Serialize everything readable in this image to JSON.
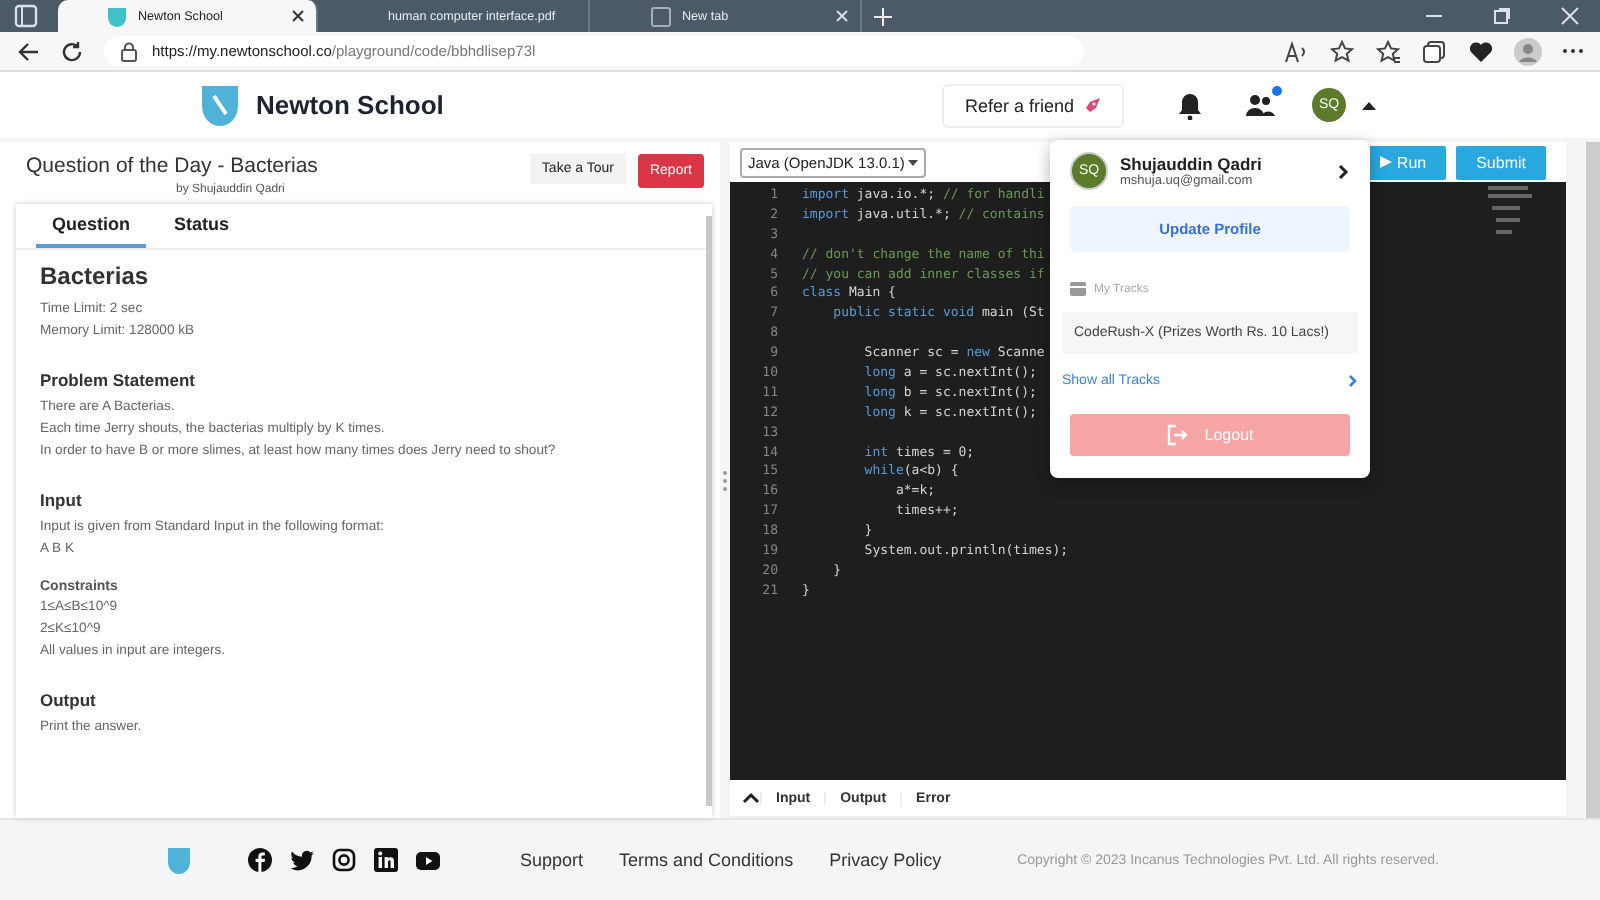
{
  "browser": {
    "tabs": [
      {
        "title": "Newton School",
        "selected": true,
        "kind": "site"
      },
      {
        "title": "human computer interface.pdf",
        "selected": false,
        "kind": "pdf"
      },
      {
        "title": "New tab",
        "selected": false,
        "kind": "blank"
      }
    ],
    "url_host": "https://my.newtonschool.co",
    "url_path": "/playground/code/bbhdlisep73l"
  },
  "header": {
    "brand": "Newton School",
    "refer": "Refer a friend",
    "avatar": "SQ",
    "notification": true
  },
  "problem": {
    "title": "Question of the Day - Bacterias",
    "author": "by Shujauddin Qadri",
    "tour": "Take a Tour",
    "report": "Report",
    "tabs": [
      {
        "label": "Question",
        "selected": true
      },
      {
        "label": "Status",
        "selected": false
      }
    ],
    "name": "Bacterias",
    "limits": [
      "Time Limit: 2 sec",
      "Memory Limit: 128000 kB"
    ],
    "sections": [
      {
        "kind": "h",
        "text": "Problem Statement"
      },
      {
        "kind": "p",
        "lines": [
          "There are A Bacterias.",
          "Each time Jerry shouts, the bacterias multiply by K times.",
          "In order to have B or more slimes, at least how many times does Jerry need to shout?"
        ]
      },
      {
        "kind": "h",
        "text": "Input"
      },
      {
        "kind": "p",
        "lines": [
          "Input is given from Standard Input in the following format:",
          "A B K"
        ]
      },
      {
        "kind": "sh",
        "text": "Constraints"
      },
      {
        "kind": "p",
        "lines": [
          "1≤A≤B≤10^9",
          "2≤K≤10^9",
          "All values in input are integers."
        ]
      },
      {
        "kind": "h",
        "text": "Output"
      },
      {
        "kind": "p",
        "lines": [
          "Print the answer."
        ]
      }
    ]
  },
  "editor": {
    "language": "Java (OpenJDK 13.0.1)",
    "run": "Run",
    "submit": "Submit",
    "lines": [
      {
        "num": "1",
        "segments": [
          {
            "text": "import",
            "kind": "keyword"
          },
          {
            "text": " java.io.*; ",
            "kind": "plain"
          },
          {
            "text": "// for handli",
            "kind": "comment"
          }
        ]
      },
      {
        "num": "2",
        "segments": [
          {
            "text": "import",
            "kind": "keyword"
          },
          {
            "text": " java.util.*; ",
            "kind": "plain"
          },
          {
            "text": "// contains",
            "kind": "comment"
          }
        ]
      },
      {
        "num": "3"
      },
      {
        "num": "4",
        "segments": [
          {
            "text": "// don't change the name of thi",
            "kind": "comment"
          }
        ]
      },
      {
        "num": "5",
        "segments": [
          {
            "text": "// you can add inner classes if",
            "kind": "comment"
          }
        ]
      },
      {
        "num": "6",
        "segments": [
          {
            "text": "class",
            "kind": "keyword"
          },
          {
            "text": " Main {",
            "kind": "plain"
          }
        ]
      },
      {
        "num": "7",
        "segments": [
          {
            "text": "    public static void",
            "kind": "keyword"
          },
          {
            "text": " main (St",
            "kind": "plain"
          }
        ]
      },
      {
        "num": "8"
      },
      {
        "num": "9",
        "segments": [
          {
            "text": "        Scanner sc = ",
            "kind": "plain"
          },
          {
            "text": "new",
            "kind": "keyword"
          },
          {
            "text": " Scanne",
            "kind": "plain"
          }
        ]
      },
      {
        "num": "10",
        "segments": [
          {
            "text": "        long",
            "kind": "keyword"
          },
          {
            "text": " a = sc.nextInt();",
            "kind": "plain"
          }
        ]
      },
      {
        "num": "11",
        "segments": [
          {
            "text": "        long",
            "kind": "keyword"
          },
          {
            "text": " b = sc.nextInt();",
            "kind": "plain"
          }
        ]
      },
      {
        "num": "12",
        "segments": [
          {
            "text": "        long",
            "kind": "keyword"
          },
          {
            "text": " k = sc.nextInt();",
            "kind": "plain"
          }
        ]
      },
      {
        "num": "13"
      },
      {
        "num": "14",
        "segments": [
          {
            "text": "        int",
            "kind": "keyword"
          },
          {
            "text": " times = 0;",
            "kind": "plain"
          }
        ]
      },
      {
        "num": "15",
        "segments": [
          {
            "text": "        while",
            "kind": "keyword"
          },
          {
            "text": "(a<b) {",
            "kind": "plain"
          }
        ]
      },
      {
        "num": "16",
        "segments": [
          {
            "text": "            a*=k;",
            "kind": "plain"
          }
        ]
      },
      {
        "num": "17",
        "segments": [
          {
            "text": "            times++;",
            "kind": "plain"
          }
        ]
      },
      {
        "num": "18",
        "segments": [
          {
            "text": "        }",
            "kind": "plain"
          }
        ]
      },
      {
        "num": "19",
        "segments": [
          {
            "text": "        System.out.println(times);",
            "kind": "plain"
          }
        ]
      },
      {
        "num": "20",
        "segments": [
          {
            "text": "    }",
            "kind": "plain"
          }
        ]
      },
      {
        "num": "21",
        "segments": [
          {
            "text": "}",
            "kind": "plain"
          }
        ]
      }
    ],
    "bottom_tabs": [
      "Input",
      "Output",
      "Error"
    ]
  },
  "menu": {
    "name": "Shujauddin Qadri",
    "email": "mshuja.uq@gmail.com",
    "avatar": "SQ",
    "update": "Update Profile",
    "tracks_label": "My Tracks",
    "track": "CodeRush-X (Prizes Worth Rs. 10 Lacs!)",
    "show_all": "Show all Tracks",
    "logout": "Logout"
  },
  "footer": {
    "links": [
      "Support",
      "Terms and Conditions",
      "Privacy Policy"
    ],
    "copyright": "Copyright © 2023 Incanus Technologies Pvt. Ltd. All rights reserved."
  }
}
